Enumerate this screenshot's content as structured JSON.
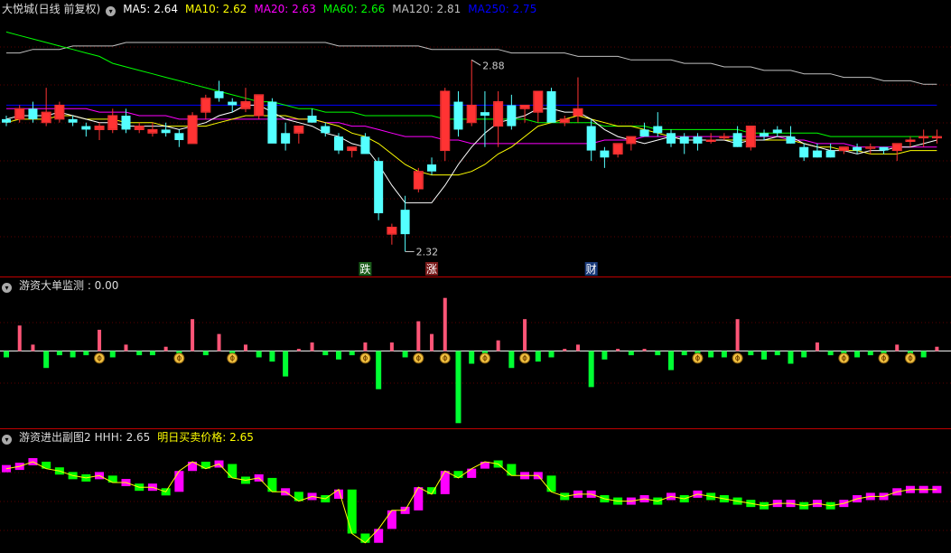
{
  "colors": {
    "up": "#ff3333",
    "down": "#54ffff",
    "ma5": "#ffffff",
    "ma10": "#ffff00",
    "ma20": "#ff00ff",
    "ma60": "#00ff00",
    "ma120": "#c0c0c0",
    "ma250": "#0000ff",
    "pos": "#ff5577",
    "neg": "#00ff33",
    "magenta": "#ff00ff",
    "green": "#00ff00"
  },
  "main": {
    "title": "大悦城(日线 前复权)",
    "indicators": [
      {
        "label": "MA5: 2.64",
        "color": "#ffffff"
      },
      {
        "label": "MA10: 2.62",
        "color": "#ffff00"
      },
      {
        "label": "MA20: 2.63",
        "color": "#ff00ff"
      },
      {
        "label": "MA60: 2.66",
        "color": "#00ff00"
      },
      {
        "label": "MA120: 2.81",
        "color": "#c0c0c0"
      },
      {
        "label": "MA250: 2.75",
        "color": "#0000ff"
      }
    ],
    "high_label": "2.88",
    "low_label": "2.32",
    "tags": [
      {
        "text": "跌",
        "idx": 27,
        "bg": "#1a5c1a"
      },
      {
        "text": "涨",
        "idx": 32,
        "bg": "#7a1a1a"
      },
      {
        "text": "财",
        "idx": 44,
        "bg": "#1a3a7a"
      }
    ]
  },
  "sub1": {
    "title": "游资大单监测",
    "value_label": "游资大单监测 : 0.00"
  },
  "sub2": {
    "title": "游资进出副图2",
    "hhh_label": "HHH: 2.65",
    "price_label": "明日买卖价格: 2.65"
  },
  "chart_data": {
    "type": "candlestick",
    "ylim": [
      2.3,
      3.0
    ],
    "candles": [
      [
        2.71,
        2.72,
        2.69,
        2.7
      ],
      [
        2.71,
        2.75,
        2.7,
        2.74
      ],
      [
        2.74,
        2.76,
        2.7,
        2.71
      ],
      [
        2.7,
        2.8,
        2.69,
        2.73
      ],
      [
        2.71,
        2.76,
        2.7,
        2.75
      ],
      [
        2.71,
        2.72,
        2.69,
        2.7
      ],
      [
        2.69,
        2.7,
        2.66,
        2.68
      ],
      [
        2.68,
        2.7,
        2.65,
        2.69
      ],
      [
        2.68,
        2.74,
        2.67,
        2.72
      ],
      [
        2.72,
        2.74,
        2.67,
        2.68
      ],
      [
        2.68,
        2.7,
        2.67,
        2.69
      ],
      [
        2.67,
        2.7,
        2.66,
        2.68
      ],
      [
        2.68,
        2.7,
        2.66,
        2.67
      ],
      [
        2.67,
        2.68,
        2.63,
        2.65
      ],
      [
        2.64,
        2.73,
        2.64,
        2.72
      ],
      [
        2.73,
        2.78,
        2.71,
        2.77
      ],
      [
        2.79,
        2.82,
        2.76,
        2.77
      ],
      [
        2.76,
        2.77,
        2.73,
        2.75
      ],
      [
        2.74,
        2.8,
        2.73,
        2.76
      ],
      [
        2.72,
        2.76,
        2.71,
        2.78
      ],
      [
        2.76,
        2.77,
        2.69,
        2.64
      ],
      [
        2.67,
        2.7,
        2.62,
        2.64
      ],
      [
        2.67,
        2.69,
        2.64,
        2.69
      ],
      [
        2.72,
        2.74,
        2.7,
        2.7
      ],
      [
        2.69,
        2.7,
        2.66,
        2.67
      ],
      [
        2.66,
        2.67,
        2.61,
        2.62
      ],
      [
        2.62,
        2.63,
        2.6,
        2.63
      ],
      [
        2.66,
        2.67,
        2.62,
        2.61
      ],
      [
        2.59,
        2.6,
        2.42,
        2.44
      ],
      [
        2.38,
        2.41,
        2.35,
        2.4
      ],
      [
        2.45,
        2.49,
        2.33,
        2.38
      ],
      [
        2.51,
        2.57,
        2.5,
        2.56
      ],
      [
        2.58,
        2.6,
        2.55,
        2.56
      ],
      [
        2.62,
        2.8,
        2.59,
        2.79
      ],
      [
        2.76,
        2.79,
        2.66,
        2.68
      ],
      [
        2.7,
        2.88,
        2.69,
        2.75
      ],
      [
        2.73,
        2.79,
        2.63,
        2.72
      ],
      [
        2.69,
        2.79,
        2.63,
        2.76
      ],
      [
        2.75,
        2.78,
        2.68,
        2.69
      ],
      [
        2.74,
        2.75,
        2.7,
        2.75
      ],
      [
        2.73,
        2.79,
        2.7,
        2.79
      ],
      [
        2.79,
        2.8,
        2.71,
        2.7
      ],
      [
        2.7,
        2.72,
        2.69,
        2.71
      ],
      [
        2.72,
        2.83,
        2.7,
        2.74
      ],
      [
        2.69,
        2.71,
        2.59,
        2.62
      ],
      [
        2.62,
        2.63,
        2.57,
        2.6
      ],
      [
        2.61,
        2.63,
        2.6,
        2.64
      ],
      [
        2.64,
        2.65,
        2.62,
        2.66
      ],
      [
        2.68,
        2.7,
        2.66,
        2.66
      ],
      [
        2.69,
        2.73,
        2.66,
        2.67
      ],
      [
        2.67,
        2.68,
        2.63,
        2.64
      ],
      [
        2.66,
        2.67,
        2.61,
        2.64
      ],
      [
        2.66,
        2.67,
        2.62,
        2.64
      ],
      [
        2.65,
        2.67,
        2.64,
        2.65
      ],
      [
        2.66,
        2.67,
        2.65,
        2.66
      ],
      [
        2.67,
        2.69,
        2.63,
        2.63
      ],
      [
        2.63,
        2.69,
        2.62,
        2.69
      ],
      [
        2.67,
        2.68,
        2.65,
        2.66
      ],
      [
        2.68,
        2.69,
        2.66,
        2.67
      ],
      [
        2.66,
        2.69,
        2.64,
        2.64
      ],
      [
        2.63,
        2.64,
        2.59,
        2.6
      ],
      [
        2.62,
        2.64,
        2.6,
        2.6
      ],
      [
        2.62,
        2.64,
        2.6,
        2.6
      ],
      [
        2.62,
        2.63,
        2.61,
        2.63
      ],
      [
        2.63,
        2.64,
        2.61,
        2.62
      ],
      [
        2.63,
        2.64,
        2.61,
        2.63
      ],
      [
        2.63,
        2.63,
        2.61,
        2.62
      ],
      [
        2.62,
        2.64,
        2.59,
        2.64
      ],
      [
        2.65,
        2.66,
        2.63,
        2.65
      ],
      [
        2.66,
        2.68,
        2.63,
        2.66
      ],
      [
        2.66,
        2.68,
        2.64,
        2.66
      ]
    ],
    "ma5": [
      2.71,
      2.72,
      2.72,
      2.72,
      2.73,
      2.72,
      2.71,
      2.7,
      2.7,
      2.69,
      2.69,
      2.69,
      2.69,
      2.68,
      2.69,
      2.7,
      2.72,
      2.73,
      2.75,
      2.75,
      2.73,
      2.71,
      2.7,
      2.69,
      2.67,
      2.66,
      2.64,
      2.63,
      2.58,
      2.52,
      2.47,
      2.47,
      2.47,
      2.52,
      2.58,
      2.63,
      2.67,
      2.7,
      2.71,
      2.72,
      2.74,
      2.74,
      2.73,
      2.73,
      2.71,
      2.68,
      2.66,
      2.65,
      2.64,
      2.65,
      2.66,
      2.65,
      2.65,
      2.65,
      2.65,
      2.64,
      2.65,
      2.65,
      2.66,
      2.66,
      2.64,
      2.63,
      2.62,
      2.62,
      2.61,
      2.62,
      2.62,
      2.63,
      2.63,
      2.64,
      2.65
    ],
    "ma10": [
      2.7,
      2.71,
      2.71,
      2.71,
      2.72,
      2.72,
      2.71,
      2.71,
      2.71,
      2.7,
      2.7,
      2.7,
      2.69,
      2.69,
      2.69,
      2.69,
      2.7,
      2.71,
      2.72,
      2.72,
      2.72,
      2.72,
      2.71,
      2.71,
      2.7,
      2.69,
      2.67,
      2.66,
      2.64,
      2.61,
      2.58,
      2.56,
      2.55,
      2.55,
      2.55,
      2.56,
      2.58,
      2.61,
      2.63,
      2.66,
      2.69,
      2.7,
      2.71,
      2.72,
      2.71,
      2.7,
      2.69,
      2.69,
      2.68,
      2.67,
      2.66,
      2.65,
      2.65,
      2.65,
      2.65,
      2.65,
      2.65,
      2.65,
      2.65,
      2.65,
      2.64,
      2.63,
      2.63,
      2.62,
      2.62,
      2.61,
      2.61,
      2.61,
      2.62,
      2.62,
      2.62
    ],
    "ma20": [
      2.74,
      2.74,
      2.74,
      2.74,
      2.74,
      2.74,
      2.74,
      2.73,
      2.73,
      2.73,
      2.72,
      2.72,
      2.72,
      2.71,
      2.71,
      2.71,
      2.71,
      2.71,
      2.71,
      2.71,
      2.71,
      2.71,
      2.71,
      2.71,
      2.7,
      2.7,
      2.69,
      2.69,
      2.68,
      2.67,
      2.66,
      2.66,
      2.66,
      2.65,
      2.65,
      2.64,
      2.64,
      2.64,
      2.64,
      2.64,
      2.64,
      2.64,
      2.64,
      2.64,
      2.64,
      2.65,
      2.65,
      2.65,
      2.66,
      2.66,
      2.66,
      2.66,
      2.66,
      2.66,
      2.66,
      2.66,
      2.66,
      2.66,
      2.66,
      2.65,
      2.65,
      2.64,
      2.64,
      2.64,
      2.63,
      2.63,
      2.63,
      2.63,
      2.63,
      2.63,
      2.63
    ],
    "ma60": [
      2.96,
      2.95,
      2.94,
      2.93,
      2.92,
      2.91,
      2.9,
      2.89,
      2.87,
      2.86,
      2.85,
      2.84,
      2.83,
      2.82,
      2.81,
      2.8,
      2.79,
      2.78,
      2.77,
      2.76,
      2.76,
      2.75,
      2.74,
      2.74,
      2.73,
      2.73,
      2.73,
      2.72,
      2.72,
      2.72,
      2.72,
      2.72,
      2.72,
      2.71,
      2.71,
      2.71,
      2.71,
      2.71,
      2.71,
      2.71,
      2.7,
      2.7,
      2.7,
      2.7,
      2.7,
      2.69,
      2.69,
      2.69,
      2.69,
      2.68,
      2.68,
      2.68,
      2.68,
      2.68,
      2.68,
      2.68,
      2.67,
      2.67,
      2.67,
      2.67,
      2.67,
      2.67,
      2.66,
      2.66,
      2.66,
      2.66,
      2.66,
      2.66,
      2.66,
      2.66,
      2.66
    ],
    "ma120": [
      2.9,
      2.9,
      2.91,
      2.91,
      2.91,
      2.92,
      2.92,
      2.92,
      2.92,
      2.93,
      2.93,
      2.93,
      2.93,
      2.93,
      2.93,
      2.93,
      2.93,
      2.93,
      2.93,
      2.93,
      2.93,
      2.93,
      2.93,
      2.93,
      2.93,
      2.92,
      2.92,
      2.92,
      2.92,
      2.92,
      2.92,
      2.92,
      2.91,
      2.91,
      2.91,
      2.91,
      2.91,
      2.91,
      2.9,
      2.9,
      2.9,
      2.9,
      2.9,
      2.89,
      2.89,
      2.89,
      2.89,
      2.88,
      2.88,
      2.88,
      2.88,
      2.87,
      2.87,
      2.87,
      2.86,
      2.86,
      2.86,
      2.85,
      2.85,
      2.85,
      2.84,
      2.84,
      2.84,
      2.83,
      2.83,
      2.83,
      2.82,
      2.82,
      2.82,
      2.81,
      2.81
    ],
    "ma250": [
      2.75,
      2.75,
      2.75,
      2.75,
      2.75,
      2.75,
      2.75,
      2.75,
      2.75,
      2.75,
      2.75,
      2.75,
      2.75,
      2.75,
      2.75,
      2.75,
      2.75,
      2.75,
      2.75,
      2.75,
      2.75,
      2.75,
      2.75,
      2.75,
      2.75,
      2.75,
      2.75,
      2.75,
      2.75,
      2.75,
      2.75,
      2.75,
      2.75,
      2.75,
      2.75,
      2.75,
      2.75,
      2.75,
      2.75,
      2.75,
      2.75,
      2.75,
      2.75,
      2.75,
      2.75,
      2.75,
      2.75,
      2.75,
      2.75,
      2.75,
      2.75,
      2.75,
      2.75,
      2.75,
      2.75,
      2.75,
      2.75,
      2.75,
      2.75,
      2.75,
      2.75,
      2.75,
      2.75,
      2.75,
      2.75,
      2.75,
      2.75,
      2.75,
      2.75,
      2.75,
      2.75
    ],
    "monitor": [
      -0.3,
      1.2,
      0.3,
      -0.8,
      -0.2,
      -0.3,
      -0.2,
      1.0,
      -0.3,
      0.3,
      -0.2,
      -0.2,
      0.2,
      -0.5,
      1.5,
      -0.2,
      0.8,
      -0.4,
      0.3,
      -0.3,
      -0.5,
      -1.2,
      0.1,
      0.4,
      -0.2,
      -0.4,
      -0.2,
      0.4,
      -1.8,
      0.4,
      -0.3,
      1.4,
      0.8,
      2.5,
      -3.4,
      -0.6,
      -0.3,
      0.5,
      -0.8,
      1.5,
      -0.5,
      -0.3,
      0.1,
      0.3,
      -1.7,
      -0.4,
      0.1,
      -0.2,
      0.1,
      -0.2,
      -0.9,
      -0.2,
      -0.3,
      -0.3,
      -0.3,
      1.5,
      -0.2,
      -0.4,
      -0.2,
      -0.6,
      -0.3,
      0.4,
      -0.2,
      -0.3,
      -0.3,
      -0.2,
      -0.3,
      0.3,
      -0.2,
      -0.3,
      0.2
    ],
    "monitor_ylim": [
      -3.6,
      2.7
    ],
    "coins": [
      7,
      13,
      17,
      27,
      31,
      33,
      36,
      39,
      52,
      55,
      63,
      66,
      68
    ],
    "hhh": [
      2.74,
      2.75,
      2.77,
      2.74,
      2.73,
      2.71,
      2.7,
      2.71,
      2.68,
      2.68,
      2.66,
      2.66,
      2.64,
      2.73,
      2.77,
      2.74,
      2.76,
      2.7,
      2.69,
      2.7,
      2.64,
      2.64,
      2.6,
      2.62,
      2.61,
      2.65,
      2.46,
      2.42,
      2.48,
      2.56,
      2.56,
      2.66,
      2.63,
      2.73,
      2.7,
      2.74,
      2.77,
      2.76,
      2.71,
      2.71,
      2.71,
      2.64,
      2.62,
      2.63,
      2.63,
      2.61,
      2.6,
      2.6,
      2.61,
      2.6,
      2.62,
      2.61,
      2.63,
      2.62,
      2.61,
      2.6,
      2.59,
      2.58,
      2.59,
      2.59,
      2.58,
      2.59,
      2.58,
      2.59,
      2.61,
      2.62,
      2.62,
      2.64,
      2.65,
      2.65,
      2.65
    ],
    "sub2_ylim": [
      2.38,
      2.84
    ]
  }
}
